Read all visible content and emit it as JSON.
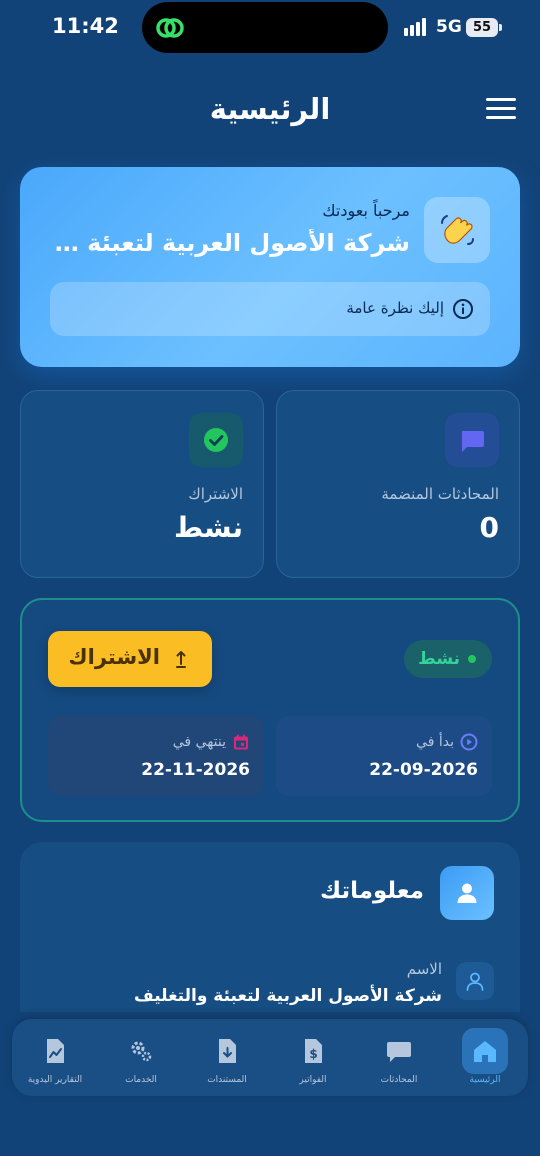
{
  "status_bar": {
    "time": "11:42",
    "network": "5G",
    "battery": "55"
  },
  "header": {
    "title": "الرئيسية"
  },
  "welcome": {
    "greeting": "مرحباً بعودتك",
    "company_name": "شركة الأصول العربية لتعبئة والت...",
    "overview_label": "إليك نظرة عامة"
  },
  "stats": {
    "conversations": {
      "label": "المحادثات المنضمة",
      "value": "0"
    },
    "subscription": {
      "label": "الاشتراك",
      "value": "نشط"
    }
  },
  "subscription_card": {
    "status": "نشط",
    "button_label": "الاشتراك",
    "start_label": "بدأ في",
    "start_date": "22-09-2026",
    "end_label": "ينتهي في",
    "end_date": "22-11-2026"
  },
  "profile": {
    "title": "معلوماتك",
    "name_label": "الاسم",
    "name_value": "شركة الأصول العربية لتعبئة والتغليف"
  },
  "nav": {
    "home": "الرئيسية",
    "chats": "المحادثات",
    "invoices": "الفواتير",
    "documents": "المستندات",
    "services": "الخدمات",
    "manual_reports": "التقارير اليدوية"
  },
  "colors": {
    "background": "#124378",
    "accent_blue": "#4aa8fb",
    "active_green": "#34d399",
    "button_yellow": "#fbbd24"
  }
}
